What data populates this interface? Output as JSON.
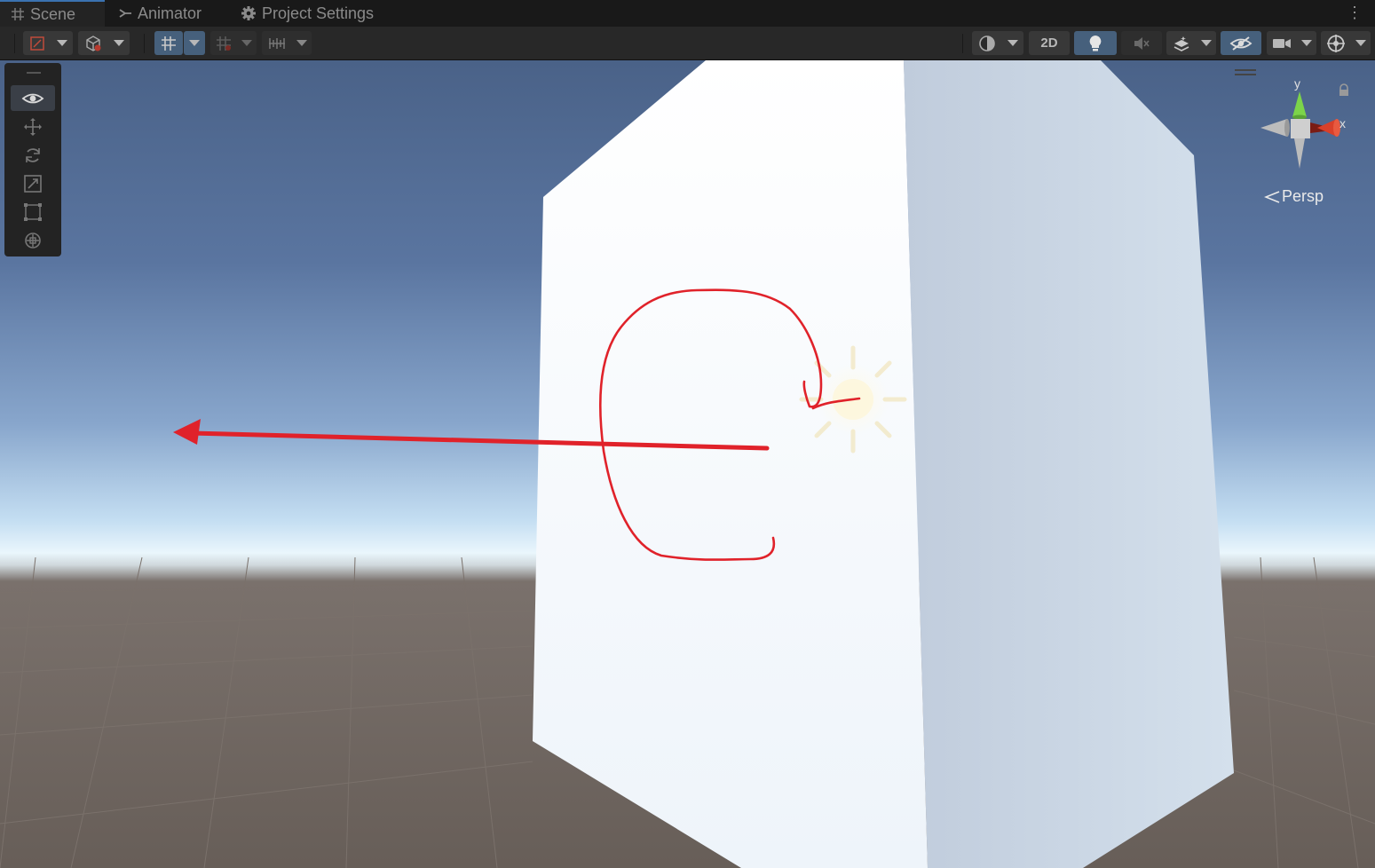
{
  "tabs": [
    {
      "label": "Scene",
      "icon": "grid-hash-icon",
      "active": true
    },
    {
      "label": "Animator",
      "icon": "animator-icon",
      "active": false
    },
    {
      "label": "Project Settings",
      "icon": "gear-icon",
      "active": false
    }
  ],
  "toolbar": {
    "draw_mode_icon": "draw-mode-icon",
    "shading_icon": "shading-cube-icon",
    "grid_snap_icon": "grid-snap-icon",
    "increment_snap_icon": "increment-snap-icon",
    "ruler_icon": "ruler-icon",
    "render_icon": "render-sphere-icon",
    "mode_2d_label": "2D",
    "lighting_icon": "lightbulb-icon",
    "audio_icon": "audio-muted-icon",
    "effects_icon": "effects-layers-icon",
    "visibility_icon": "hidden-eye-icon",
    "camera_icon": "camera-icon",
    "gizmos_icon": "gizmos-icon",
    "lighting_on": true
  },
  "tools": [
    {
      "name": "view-tool",
      "icon": "eye-icon",
      "active": true
    },
    {
      "name": "move-tool",
      "icon": "move-arrows-icon",
      "active": false
    },
    {
      "name": "rotate-tool",
      "icon": "rotate-icon",
      "active": false
    },
    {
      "name": "scale-tool",
      "icon": "scale-icon",
      "active": false
    },
    {
      "name": "rect-tool",
      "icon": "rect-transform-icon",
      "active": false
    },
    {
      "name": "transform-tool",
      "icon": "transform-icon",
      "active": false
    }
  ],
  "gizmo": {
    "y_label": "y",
    "x_label": "x",
    "projection_label": "Persp",
    "y_color": "#7cd44a",
    "x_color": "#d8402a"
  },
  "scene": {
    "sky_top_color": "#4a6288",
    "horizon_color": "#e8f4ff",
    "ground_color": "#6a625d",
    "cube_front_color": "#f0f6fc",
    "cube_side_color": "#c8d4e4",
    "annotation_color": "#e0222a",
    "light_icon": "directional-light-icon"
  }
}
